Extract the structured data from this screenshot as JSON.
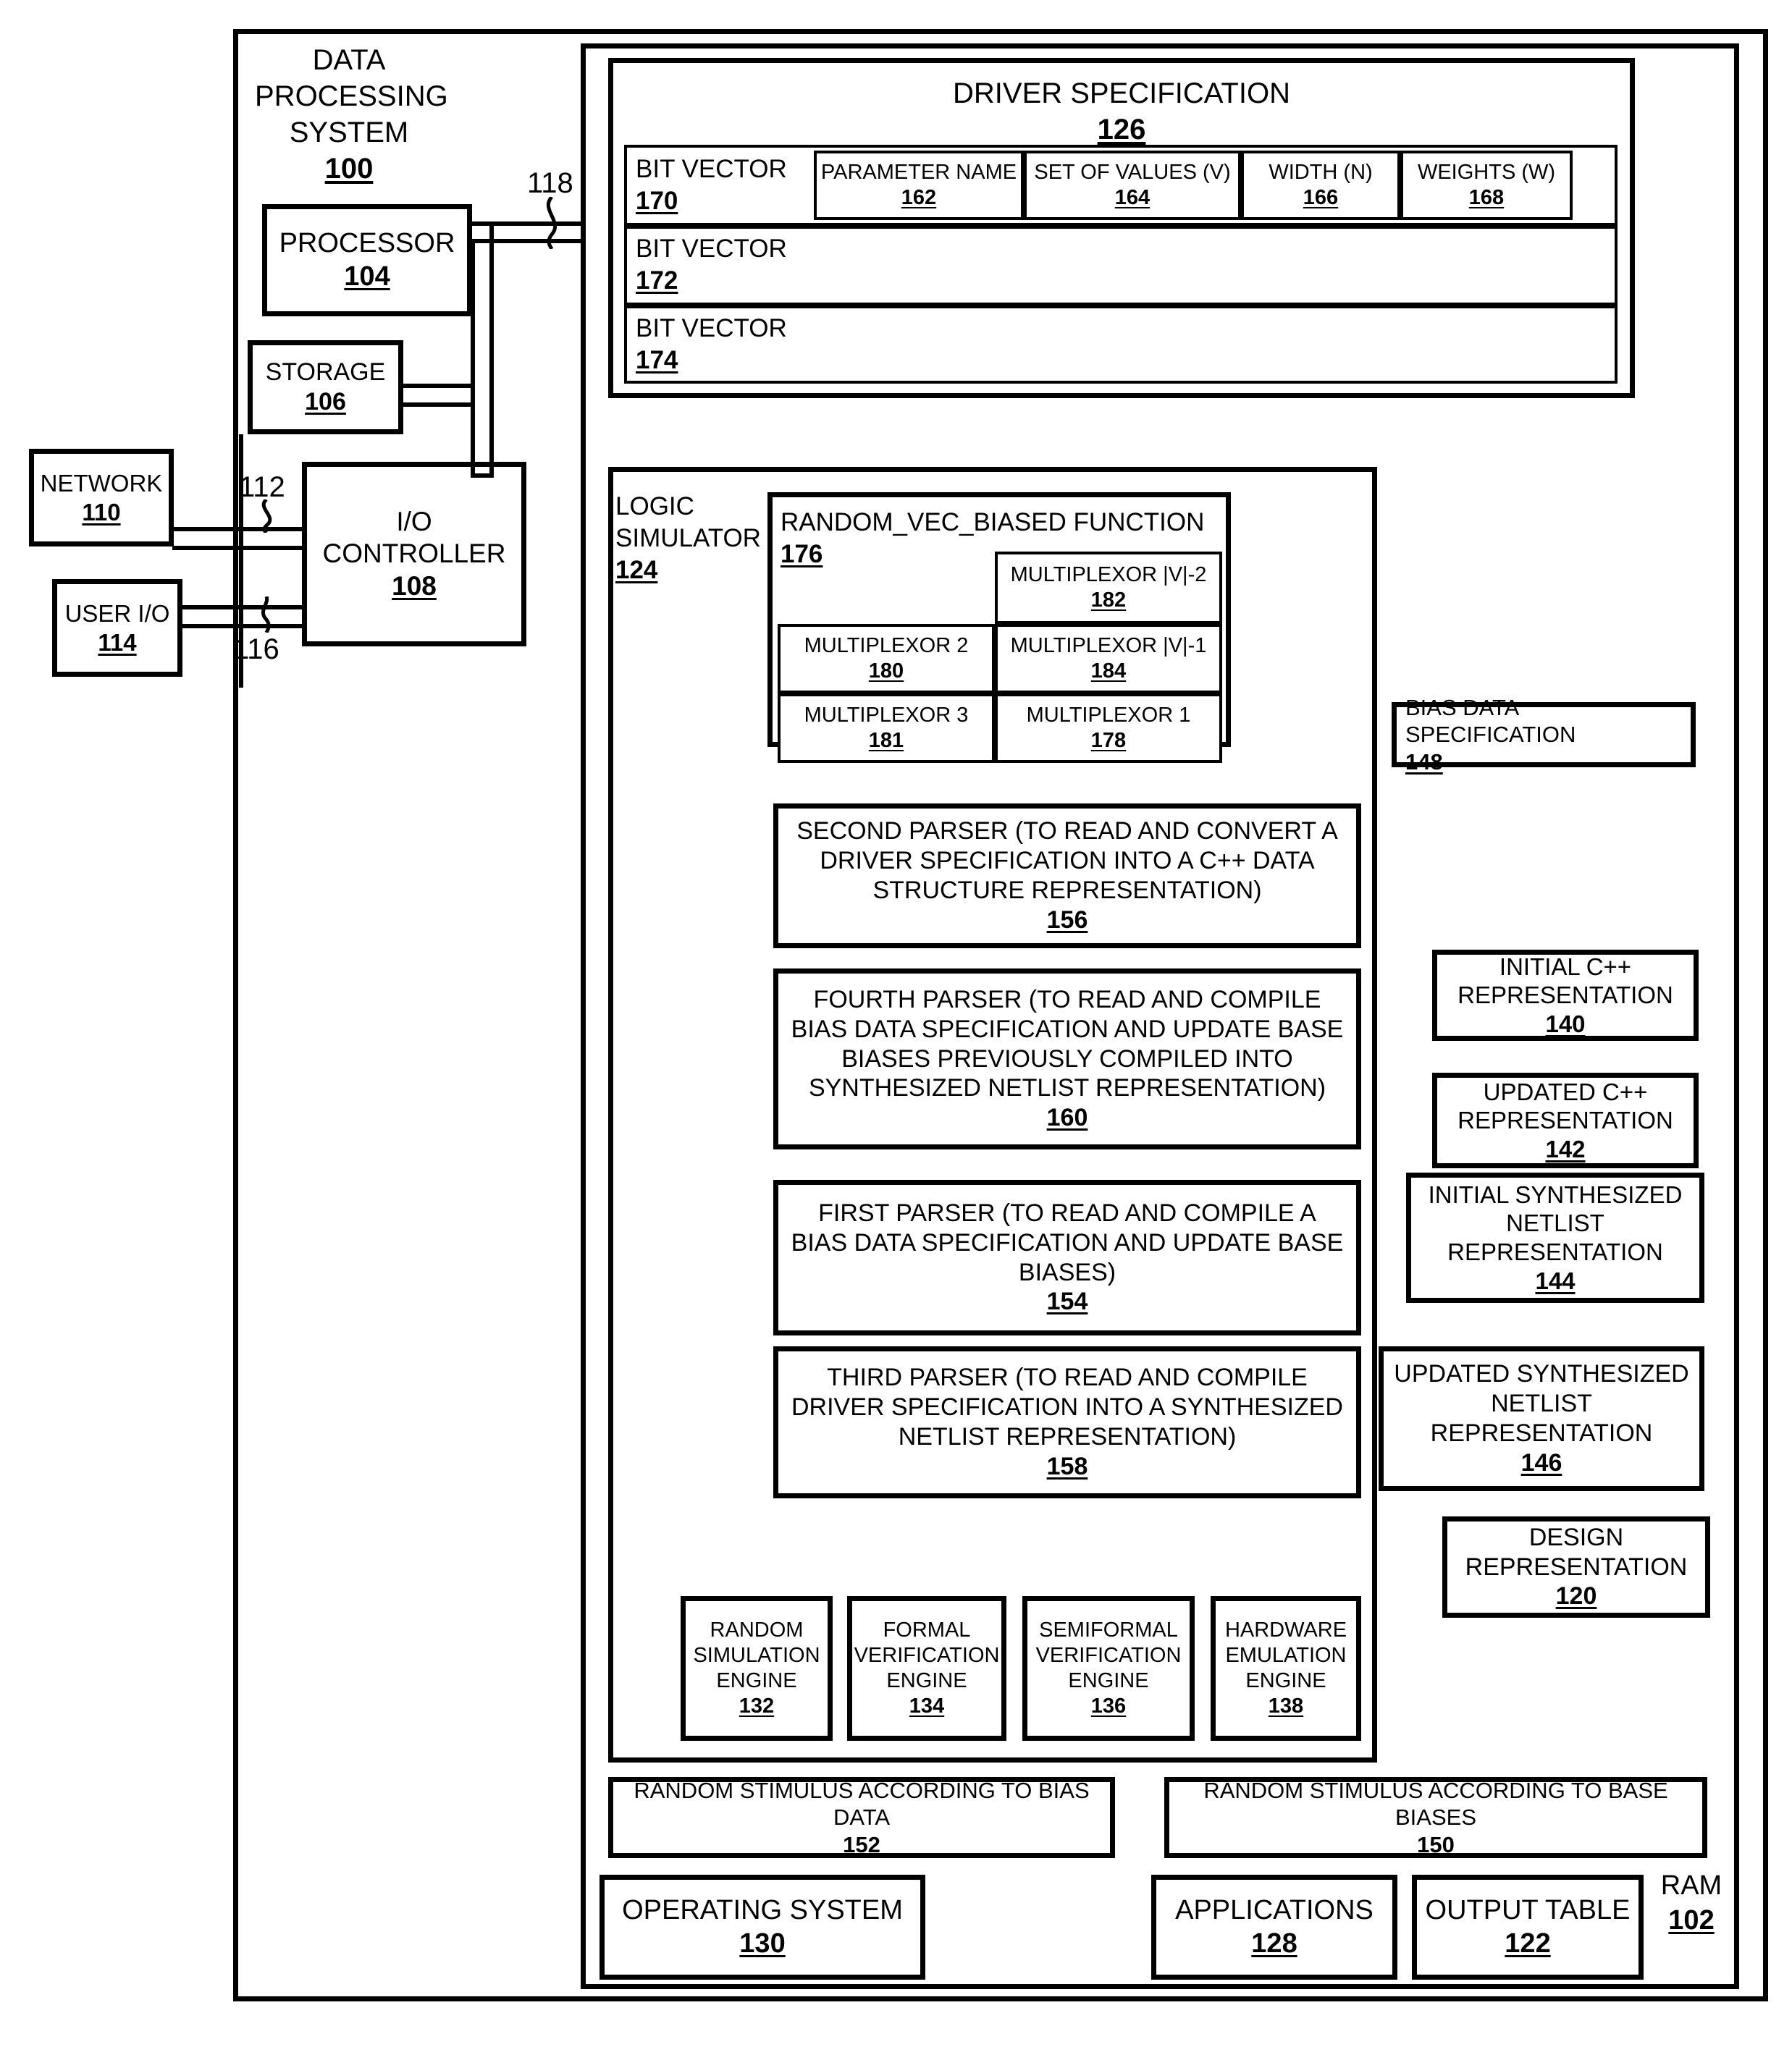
{
  "figure": {
    "system": {
      "label_line1": "DATA",
      "label_line2": "PROCESSING",
      "label_line3": "SYSTEM",
      "number": "100"
    },
    "ram": {
      "label": "RAM",
      "number": "102"
    },
    "processor": {
      "label": "PROCESSOR",
      "number": "104"
    },
    "storage": {
      "label": "STORAGE",
      "number": "106"
    },
    "io_controller": {
      "label_line1": "I/O",
      "label_line2": "CONTROLLER",
      "number": "108"
    },
    "network": {
      "label": "NETWORK",
      "number": "110"
    },
    "user_io": {
      "label": "USER I/O",
      "number": "114"
    },
    "bus_labels": {
      "bus_118": "118",
      "bus_112": "112",
      "bus_116": "116"
    },
    "driver_specification": {
      "title": "DRIVER SPECIFICATION",
      "number": "126",
      "columns": [
        {
          "label": "PARAMETER NAME",
          "number": "162"
        },
        {
          "label": "SET OF VALUES (V)",
          "number": "164"
        },
        {
          "label": "WIDTH (N)",
          "number": "166"
        },
        {
          "label": "WEIGHTS (W)",
          "number": "168"
        }
      ],
      "rows": [
        {
          "label": "BIT VECTOR",
          "number": "170"
        },
        {
          "label": "BIT VECTOR",
          "number": "172"
        },
        {
          "label": "BIT VECTOR",
          "number": "174"
        }
      ]
    },
    "logic_simulator": {
      "label_line1": "LOGIC",
      "label_line2": "SIMULATOR",
      "number": "124"
    },
    "random_vec_biased": {
      "title": "RANDOM_VEC_BIASED FUNCTION",
      "number": "176",
      "multiplexors": [
        {
          "label": "MULTIPLEXOR |V|-2",
          "number": "182"
        },
        {
          "label": "MULTIPLEXOR 2",
          "number": "180"
        },
        {
          "label": "MULTIPLEXOR |V|-1",
          "number": "184"
        },
        {
          "label": "MULTIPLEXOR 3",
          "number": "181"
        },
        {
          "label": "MULTIPLEXOR 1",
          "number": "178"
        }
      ]
    },
    "parsers": [
      {
        "text": "SECOND PARSER (TO READ AND CONVERT A DRIVER SPECIFICATION INTO A C++ DATA STRUCTURE REPRESENTATION)",
        "number": "156"
      },
      {
        "text": "FOURTH PARSER (TO READ AND COMPILE BIAS DATA  SPECIFICATION AND UPDATE BASE BIASES PREVIOUSLY COMPILED INTO SYNTHESIZED NETLIST REPRESENTATION)",
        "number": "160"
      },
      {
        "text": "FIRST PARSER (TO READ AND COMPILE A BIAS DATA SPECIFICATION AND UPDATE BASE BIASES)",
        "number": "154"
      },
      {
        "text": "THIRD PARSER (TO READ AND COMPILE DRIVER SPECIFICATION INTO A SYNTHESIZED NETLIST REPRESENTATION)",
        "number": "158"
      }
    ],
    "engines": [
      {
        "text": "RANDOM SIMULATION ENGINE",
        "number": "132"
      },
      {
        "text": "FORMAL VERIFICATION ENGINE",
        "number": "134"
      },
      {
        "text": "SEMIFORMAL VERIFICATION ENGINE",
        "number": "136"
      },
      {
        "text": "HARDWARE EMULATION ENGINE",
        "number": "138"
      }
    ],
    "right_column": [
      {
        "text": "BIAS DATA SPECIFICATION",
        "number": "148"
      },
      {
        "text": "INITIAL C++ REPRESENTATION",
        "number": "140"
      },
      {
        "text": "UPDATED C++ REPRESENTATION",
        "number": "142"
      },
      {
        "text": "INITIAL SYNTHESIZED NETLIST REPRESENTATION",
        "number": "144"
      },
      {
        "text": "UPDATED SYNTHESIZED NETLIST REPRESENTATION",
        "number": "146"
      },
      {
        "text": "DESIGN REPRESENTATION",
        "number": "120"
      }
    ],
    "stimulus": [
      {
        "text": "RANDOM STIMULUS ACCORDING TO BIAS DATA",
        "number": "152"
      },
      {
        "text": "RANDOM STIMULUS ACCORDING TO BASE BIASES",
        "number": "150"
      }
    ],
    "bottom": [
      {
        "text": "OPERATING SYSTEM",
        "number": "130"
      },
      {
        "text": "APPLICATIONS",
        "number": "128"
      },
      {
        "text": "OUTPUT TABLE",
        "number": "122"
      }
    ]
  }
}
